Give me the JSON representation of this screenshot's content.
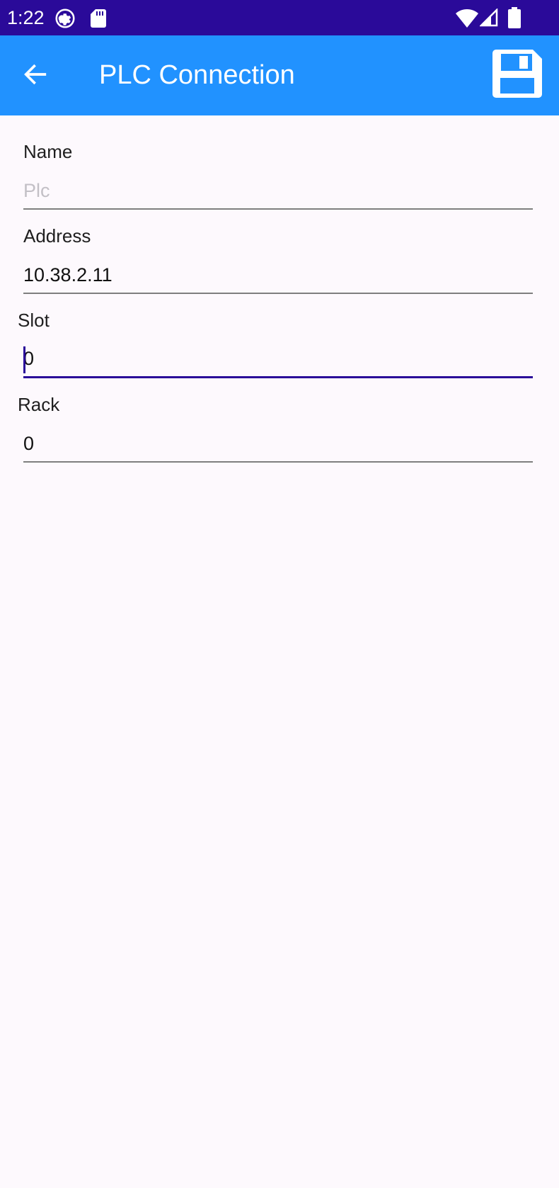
{
  "status_bar": {
    "time": "1:22",
    "icons": [
      "settings-gear-icon",
      "sd-card-icon",
      "wifi-icon",
      "cell-signal-icon",
      "battery-icon"
    ],
    "background": "#2a0a99"
  },
  "app_bar": {
    "title": "PLC Connection",
    "back_icon": "arrow-left-icon",
    "save_icon": "floppy-disk-icon",
    "background": "#2192ff"
  },
  "form": {
    "name": {
      "label": "Name",
      "value": "",
      "placeholder": "Plc"
    },
    "address": {
      "label": "Address",
      "value": "10.38.2.11",
      "placeholder": ""
    },
    "slot": {
      "label": "Slot",
      "value": "0",
      "placeholder": ""
    },
    "rack": {
      "label": "Rack",
      "value": "0",
      "placeholder": ""
    }
  },
  "colors": {
    "accent": "#2a0a99",
    "underline": "#7f7f7f",
    "page_background": "#fdf9fd"
  }
}
